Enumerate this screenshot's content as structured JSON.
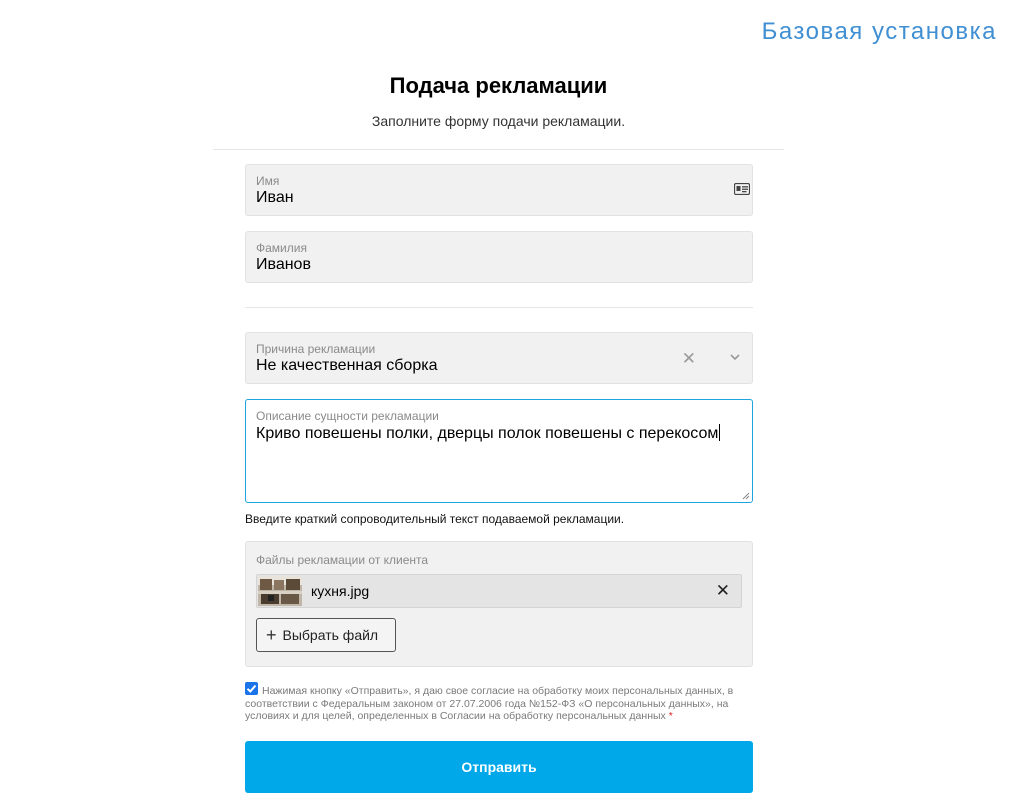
{
  "header": {
    "brand": "Базовая установка"
  },
  "form": {
    "title": "Подача рекламации",
    "subtitle": "Заполните форму подачи рекламации.",
    "name": {
      "label": "Имя",
      "value": "Иван"
    },
    "surname": {
      "label": "Фамилия",
      "value": "Иванов"
    },
    "reason": {
      "label": "Причина рекламации",
      "value": "Не качественная сборка"
    },
    "description": {
      "label": "Описание сущности рекламации",
      "value": "Криво повешены полки, дверцы полок повешены с перекосом",
      "hint": "Введите краткий сопроводительный текст подаваемой рекламации."
    },
    "files": {
      "label": "Файлы рекламации от клиента",
      "items": [
        {
          "name": "кухня.jpg"
        }
      ],
      "choose_label": "Выбрать файл"
    },
    "consent": {
      "checked": true,
      "text": "Нажимая кнопку «Отправить», я даю свое согласие на обработку моих персональных данных, в соответствии с Федеральным законом от 27.07.2006 года №152-ФЗ «О персональных данных», на условиях и для целей, определенных в Согласии на обработку персональных данных",
      "required_mark": "*"
    },
    "submit_label": "Отправить"
  },
  "icons": {
    "name_field": "id-card-icon",
    "clear": "close-icon",
    "dropdown": "chevron-down-icon",
    "remove_file": "close-icon",
    "add_file": "plus-icon",
    "checkbox": "checkmark-icon"
  },
  "colors": {
    "brand": "#3f8fd2",
    "accent": "#00a8ea",
    "focus_border": "#1ea4e0",
    "checkbox": "#1a73e8",
    "required": "#e02020"
  }
}
